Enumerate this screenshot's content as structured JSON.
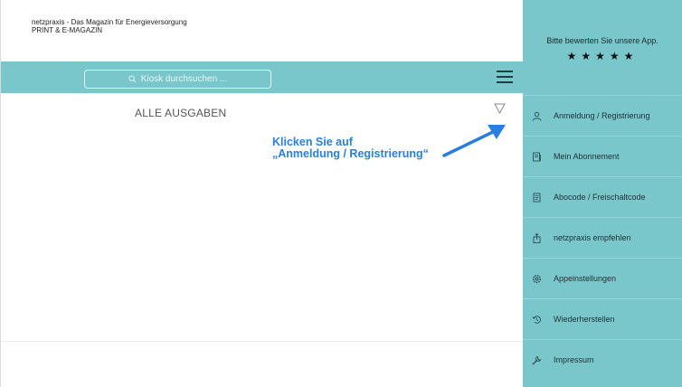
{
  "app": {
    "brand_line1": "netzpraxis - Das Magazin für Energieversorgung",
    "brand_line2": "PRINT & E-MAGAZIN"
  },
  "toolbar": {
    "search_placeholder": "Kiosk durchsuchen ...",
    "menu_icon": "hamburger-icon",
    "accent": "#79c6cb"
  },
  "content": {
    "heading": "ALLE AUSGABEN",
    "filter_icon": "filter-icon"
  },
  "annotation": {
    "line1": "Klicken Sie auf",
    "line2": "„Anmeldung / Registrierung“",
    "color": "#2a7fdc"
  },
  "side_panel": {
    "rate_text": "Bitte bewerten Sie unsere App.",
    "stars": "★★★★★",
    "items": [
      {
        "label": "Anmeldung / Registrierung",
        "icon": "user-icon"
      },
      {
        "label": "Mein Abonnement",
        "icon": "subscription-icon"
      },
      {
        "label": "Abocode / Freischaltcode",
        "icon": "document-icon"
      },
      {
        "label": "netzpraxis empfehlen",
        "icon": "share-icon"
      },
      {
        "label": "Appeinstellungen",
        "icon": "settings-icon"
      },
      {
        "label": "Wiederherstellen",
        "icon": "restore-icon"
      },
      {
        "label": "Impressum",
        "icon": "wrench-icon"
      }
    ]
  }
}
